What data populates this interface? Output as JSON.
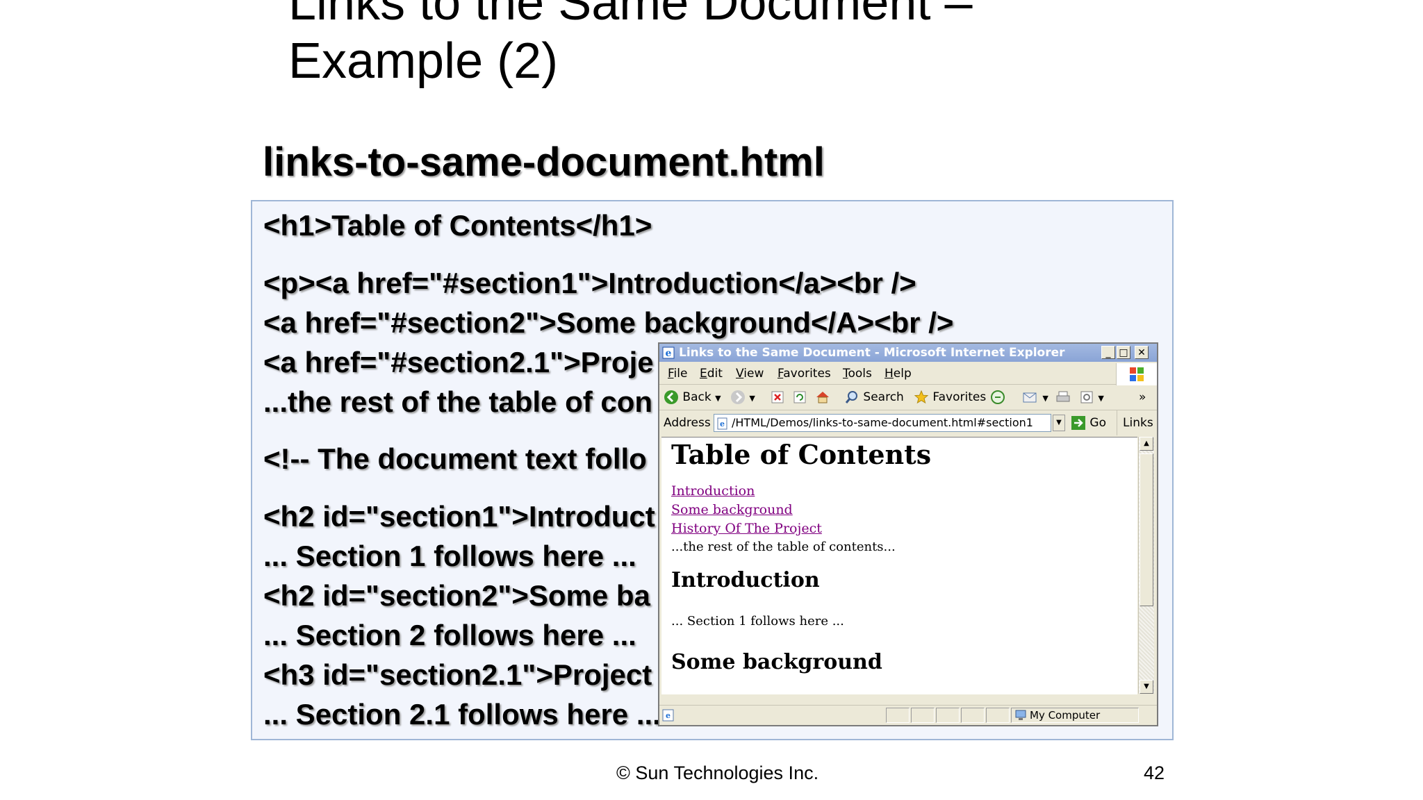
{
  "slide": {
    "title_line1": "Links to the Same Document –",
    "title_line2": "Example (2)",
    "file_heading": "links-to-same-document.html",
    "code_lines": [
      "<h1>Table of Contents</h1>",
      "<p><a href=\"#section1\">Introduction</a><br />",
      "<a href=\"#section2\">Some background</A><br />",
      "<a href=\"#section2.1\">Proje",
      "...the rest of the table of con",
      "<!-- The document text follo",
      "<h2 id=\"section1\">Introduct",
      "... Section 1 follows here ...",
      "<h2 id=\"section2\">Some ba",
      "... Section 2 follows here ...",
      "<h3 id=\"section2.1\">Project",
      "... Section 2.1 follows here ..."
    ],
    "footer_copyright": "© Sun Technologies Inc.",
    "page_number": "42"
  },
  "browser": {
    "window_title": "Links to the Same Document - Microsoft Internet Explorer",
    "menu": [
      "File",
      "Edit",
      "View",
      "Favorites",
      "Tools",
      "Help"
    ],
    "toolbar": {
      "back": "Back",
      "search": "Search",
      "favorites": "Favorites",
      "overflow": "»"
    },
    "address": {
      "label": "Address",
      "value": "/HTML/Demos/links-to-same-document.html#section1",
      "go": "Go",
      "links": "Links"
    },
    "page": {
      "h1": "Table of Contents",
      "links": [
        "Introduction",
        "Some background",
        "History Of The Project"
      ],
      "rest": "...the rest of the table of contents...",
      "h2_intro": "Introduction",
      "section1_text": "... Section 1 follows here ...",
      "h2_background": "Some background"
    },
    "status": {
      "zone": "My Computer"
    }
  }
}
